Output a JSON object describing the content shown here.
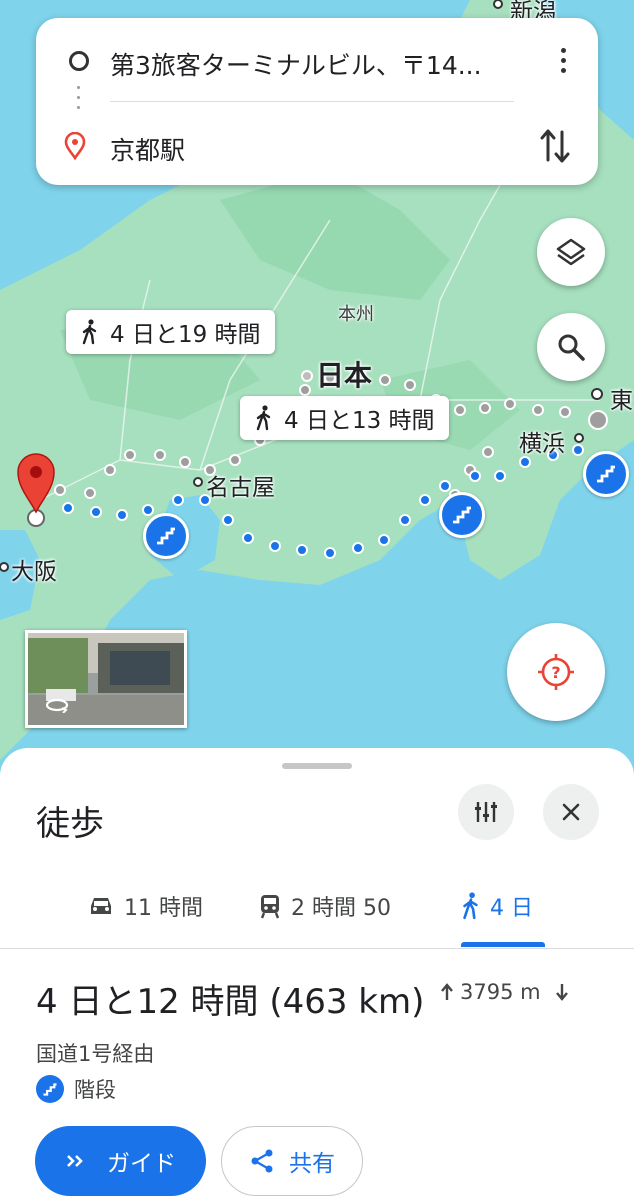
{
  "directions": {
    "origin": "第3旅客ターミナルビル、〒14...",
    "destination": "京都駅"
  },
  "map": {
    "route_labels": [
      "4 日と19 時間",
      "4 日と13 時間"
    ],
    "place_labels": {
      "niigata": "新潟",
      "honshu": "本州",
      "japan": "日本",
      "nagoya": "名古屋",
      "osaka": "大阪",
      "yokohama": "横浜",
      "tokyo": "東"
    },
    "colors": {
      "sea": "#7fd4ec",
      "land": "#a6e0bf",
      "route": "#1a73e8",
      "pin": "#ea4335"
    }
  },
  "sheet": {
    "title": "徒歩",
    "tabs": [
      {
        "icon": "car-icon",
        "label": "11 時間"
      },
      {
        "icon": "train-icon",
        "label": "2 時間 50"
      },
      {
        "icon": "walk-icon",
        "label": "4 日",
        "active": true
      }
    ],
    "duration": "4 日と12 時間 (463 km)",
    "elevation": "3795 m",
    "via": "国道1号経由",
    "warning": "階段",
    "buttons": {
      "guide": "ガイド",
      "share": "共有"
    }
  }
}
